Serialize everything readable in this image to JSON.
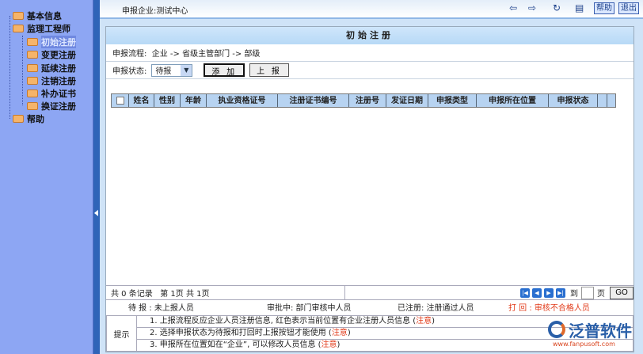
{
  "sidebar": {
    "items": [
      {
        "label": "基本信息"
      },
      {
        "label": "监理工程师"
      },
      {
        "label": "初始注册"
      },
      {
        "label": "变更注册"
      },
      {
        "label": "延续注册"
      },
      {
        "label": "注销注册"
      },
      {
        "label": "补办证书"
      },
      {
        "label": "换证注册"
      },
      {
        "label": "帮助"
      }
    ]
  },
  "topbar": {
    "company": "申报企业:测试中心",
    "back": "⇦",
    "forward": "⇨",
    "refresh": "↻",
    "folder": "▤",
    "help": "帮助",
    "exit": "退出"
  },
  "panel": {
    "title": "初始注册",
    "flow_label": "申报流程:",
    "flow": "企业 ->  省级主管部门  ->  部级",
    "status_label": "申报状态:",
    "status_value": "待报",
    "add": "添 加",
    "submit": "上 报",
    "columns": [
      "姓名",
      "性别",
      "年龄",
      "执业资格证号",
      "注册证书编号",
      "注册号",
      "发证日期",
      "申报类型",
      "申报所在位置",
      "申报状态"
    ],
    "pager": {
      "summary": "共 0 条记录   第 1页 共 1页",
      "first": "|◀",
      "prev": "◀",
      "next": "▶",
      "last": "▶|",
      "goto": "到",
      "page": "页",
      "go": "GO"
    },
    "legend": [
      "待 报 : 未上报人员",
      "审批中: 部门审核中人员",
      "已注册: 注册通过人员",
      "打 回 : 审核不合格人员"
    ],
    "tips": {
      "label": "提示",
      "lines": [
        {
          "text": "1. 上报流程反应企业人员注册信息, 红色表示当前位置有企业注册人员信息 (",
          "note": "注意",
          "end": ")"
        },
        {
          "text": "2. 选择申报状态为待报和打回时上报按钮才能使用 (",
          "note": "注意",
          "end": ")"
        },
        {
          "text": "3. 申报所在位置如在“企业”, 可以修改人员信息 (",
          "note": "注意",
          "end": ")"
        }
      ]
    }
  },
  "logo": {
    "name": "泛普软件",
    "url": "www.fanpusoft.com"
  }
}
